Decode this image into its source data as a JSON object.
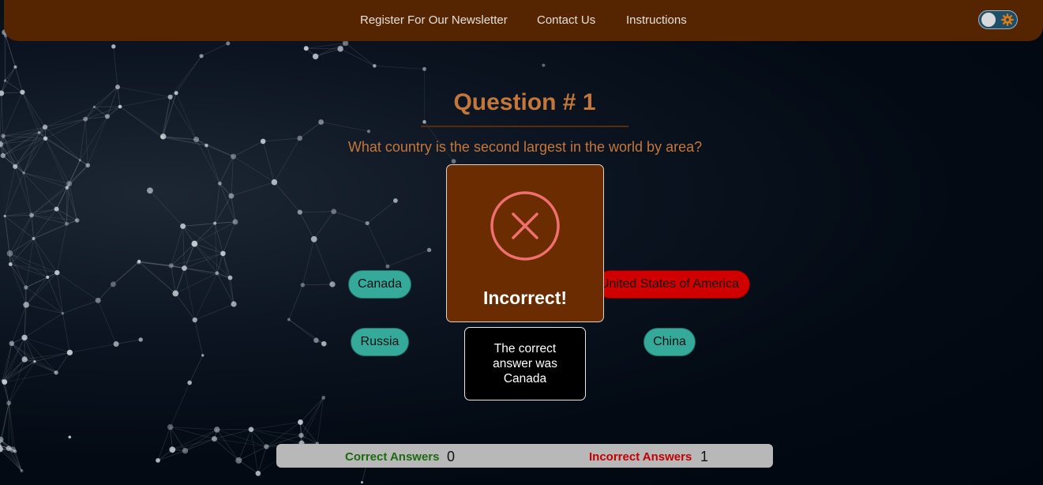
{
  "nav": {
    "links": [
      "Register For Our Newsletter",
      "Contact Us",
      "Instructions"
    ],
    "theme_toggle": {
      "state": "off",
      "icon": "gear-icon"
    }
  },
  "question": {
    "title": "Question # 1",
    "text": "What country is the second largest in the world by area?"
  },
  "answers": [
    {
      "label": "Canada",
      "status": "neutral"
    },
    {
      "label": "United States of America",
      "status": "incorrect-selected"
    },
    {
      "label": "Russia",
      "status": "neutral"
    },
    {
      "label": "China",
      "status": "neutral"
    }
  ],
  "result_modal": {
    "icon": "close-circle-icon",
    "title": "Incorrect!",
    "tooltip": "The correct answer was Canada"
  },
  "score": {
    "correct_label": "Correct Answers",
    "correct_value": "0",
    "incorrect_label": "Incorrect Answers",
    "incorrect_value": "1"
  },
  "colors": {
    "navbar": "#552400",
    "accent_text": "#c4773a",
    "answer_button": "#35a99a",
    "answer_wrong": "#d10000",
    "modal_bg": "#6a2c00",
    "correct_label": "#1b6b0f",
    "incorrect_label": "#c40000"
  }
}
